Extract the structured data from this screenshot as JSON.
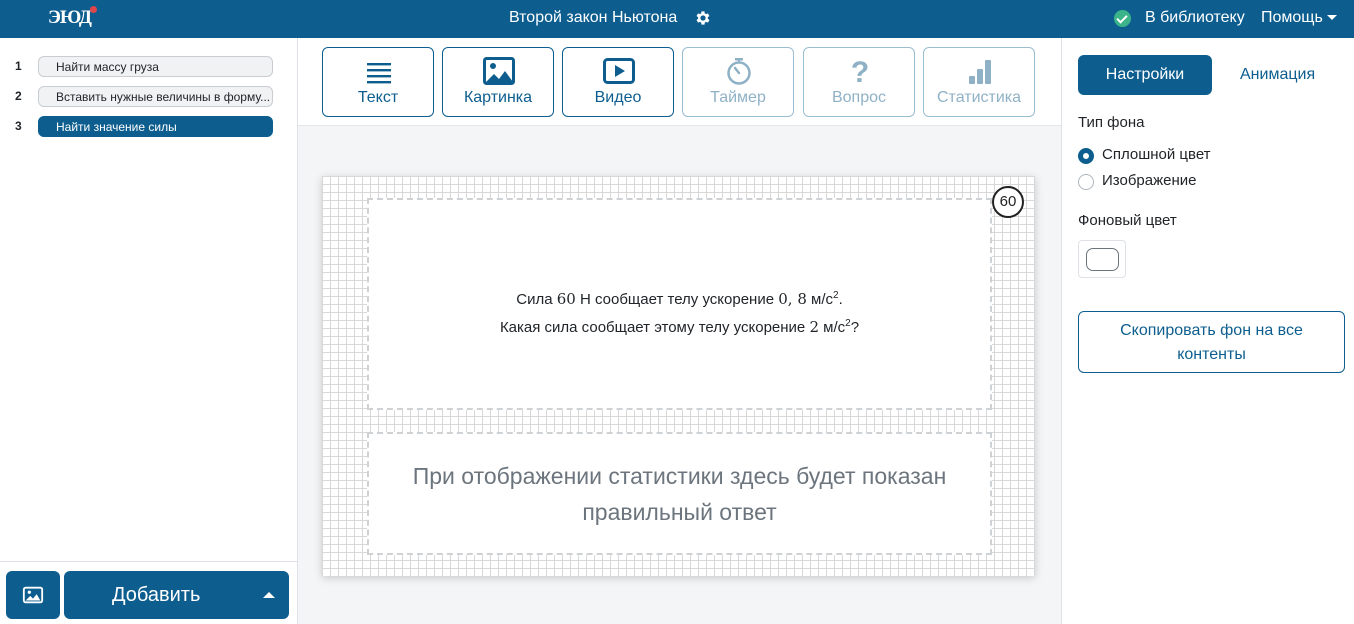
{
  "header": {
    "logo": "ЭЮД",
    "title": "Второй закон Ньютона",
    "library_link": "В библиотеку",
    "help_menu": "Помощь"
  },
  "slides": [
    {
      "num": "1",
      "label": "Найти массу груза",
      "active": false
    },
    {
      "num": "2",
      "label": "Вставить нужные величины в форму...",
      "active": false
    },
    {
      "num": "3",
      "label": "Найти значение силы",
      "active": true
    }
  ],
  "left_footer": {
    "add_label": "Добавить"
  },
  "toolbar": {
    "text": "Текст",
    "image": "Картинка",
    "video": "Видео",
    "timer": "Таймер",
    "question": "Вопрос",
    "stats": "Статистика"
  },
  "card": {
    "timer_value": "60",
    "question_line1_a": "Сила",
    "question_line1_f": "60",
    "question_line1_b": "Н сообщает телу ускорение",
    "question_line1_a2": "0, 8",
    "question_line1_unit": "м/с",
    "question_line1_end": ".",
    "question_line2_a": "Какая сила сообщает этому телу ускорение",
    "question_line2_v": "2",
    "question_line2_unit": "м/с",
    "question_line2_end": "?",
    "exponent": "2",
    "answer_placeholder_line1": "При отображении статистики здесь будет показан",
    "answer_placeholder_line2": "правильный ответ"
  },
  "settings": {
    "tab_settings": "Настройки",
    "tab_animation": "Анимация",
    "bg_type_label": "Тип фона",
    "bg_option_solid": "Сплошной цвет",
    "bg_option_image": "Изображение",
    "bg_selected": "Сплошной цвет",
    "bg_color_label": "Фоновый цвет",
    "bg_color_value": "#ffffff",
    "copy_bg_line1": "Скопировать фон на все",
    "copy_bg_line2": "контенты"
  },
  "colors": {
    "primary": "#0d5e8f",
    "success": "#3cb48a"
  }
}
